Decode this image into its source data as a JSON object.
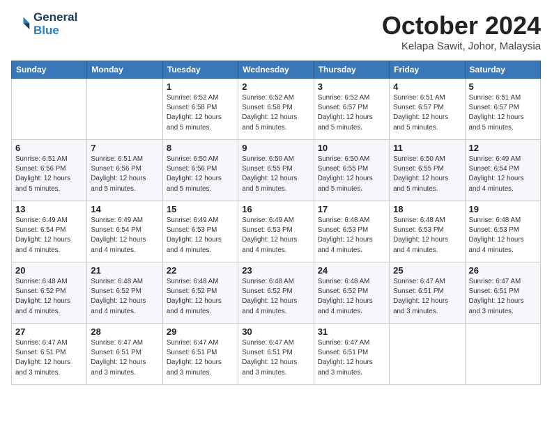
{
  "logo": {
    "line1": "General",
    "line2": "Blue"
  },
  "title": "October 2024",
  "subtitle": "Kelapa Sawit, Johor, Malaysia",
  "days_of_week": [
    "Sunday",
    "Monday",
    "Tuesday",
    "Wednesday",
    "Thursday",
    "Friday",
    "Saturday"
  ],
  "weeks": [
    [
      {
        "day": "",
        "info": ""
      },
      {
        "day": "",
        "info": ""
      },
      {
        "day": "1",
        "info": "Sunrise: 6:52 AM\nSunset: 6:58 PM\nDaylight: 12 hours and 5 minutes."
      },
      {
        "day": "2",
        "info": "Sunrise: 6:52 AM\nSunset: 6:58 PM\nDaylight: 12 hours and 5 minutes."
      },
      {
        "day": "3",
        "info": "Sunrise: 6:52 AM\nSunset: 6:57 PM\nDaylight: 12 hours and 5 minutes."
      },
      {
        "day": "4",
        "info": "Sunrise: 6:51 AM\nSunset: 6:57 PM\nDaylight: 12 hours and 5 minutes."
      },
      {
        "day": "5",
        "info": "Sunrise: 6:51 AM\nSunset: 6:57 PM\nDaylight: 12 hours and 5 minutes."
      }
    ],
    [
      {
        "day": "6",
        "info": "Sunrise: 6:51 AM\nSunset: 6:56 PM\nDaylight: 12 hours and 5 minutes."
      },
      {
        "day": "7",
        "info": "Sunrise: 6:51 AM\nSunset: 6:56 PM\nDaylight: 12 hours and 5 minutes."
      },
      {
        "day": "8",
        "info": "Sunrise: 6:50 AM\nSunset: 6:56 PM\nDaylight: 12 hours and 5 minutes."
      },
      {
        "day": "9",
        "info": "Sunrise: 6:50 AM\nSunset: 6:55 PM\nDaylight: 12 hours and 5 minutes."
      },
      {
        "day": "10",
        "info": "Sunrise: 6:50 AM\nSunset: 6:55 PM\nDaylight: 12 hours and 5 minutes."
      },
      {
        "day": "11",
        "info": "Sunrise: 6:50 AM\nSunset: 6:55 PM\nDaylight: 12 hours and 5 minutes."
      },
      {
        "day": "12",
        "info": "Sunrise: 6:49 AM\nSunset: 6:54 PM\nDaylight: 12 hours and 4 minutes."
      }
    ],
    [
      {
        "day": "13",
        "info": "Sunrise: 6:49 AM\nSunset: 6:54 PM\nDaylight: 12 hours and 4 minutes."
      },
      {
        "day": "14",
        "info": "Sunrise: 6:49 AM\nSunset: 6:54 PM\nDaylight: 12 hours and 4 minutes."
      },
      {
        "day": "15",
        "info": "Sunrise: 6:49 AM\nSunset: 6:53 PM\nDaylight: 12 hours and 4 minutes."
      },
      {
        "day": "16",
        "info": "Sunrise: 6:49 AM\nSunset: 6:53 PM\nDaylight: 12 hours and 4 minutes."
      },
      {
        "day": "17",
        "info": "Sunrise: 6:48 AM\nSunset: 6:53 PM\nDaylight: 12 hours and 4 minutes."
      },
      {
        "day": "18",
        "info": "Sunrise: 6:48 AM\nSunset: 6:53 PM\nDaylight: 12 hours and 4 minutes."
      },
      {
        "day": "19",
        "info": "Sunrise: 6:48 AM\nSunset: 6:53 PM\nDaylight: 12 hours and 4 minutes."
      }
    ],
    [
      {
        "day": "20",
        "info": "Sunrise: 6:48 AM\nSunset: 6:52 PM\nDaylight: 12 hours and 4 minutes."
      },
      {
        "day": "21",
        "info": "Sunrise: 6:48 AM\nSunset: 6:52 PM\nDaylight: 12 hours and 4 minutes."
      },
      {
        "day": "22",
        "info": "Sunrise: 6:48 AM\nSunset: 6:52 PM\nDaylight: 12 hours and 4 minutes."
      },
      {
        "day": "23",
        "info": "Sunrise: 6:48 AM\nSunset: 6:52 PM\nDaylight: 12 hours and 4 minutes."
      },
      {
        "day": "24",
        "info": "Sunrise: 6:48 AM\nSunset: 6:52 PM\nDaylight: 12 hours and 4 minutes."
      },
      {
        "day": "25",
        "info": "Sunrise: 6:47 AM\nSunset: 6:51 PM\nDaylight: 12 hours and 3 minutes."
      },
      {
        "day": "26",
        "info": "Sunrise: 6:47 AM\nSunset: 6:51 PM\nDaylight: 12 hours and 3 minutes."
      }
    ],
    [
      {
        "day": "27",
        "info": "Sunrise: 6:47 AM\nSunset: 6:51 PM\nDaylight: 12 hours and 3 minutes."
      },
      {
        "day": "28",
        "info": "Sunrise: 6:47 AM\nSunset: 6:51 PM\nDaylight: 12 hours and 3 minutes."
      },
      {
        "day": "29",
        "info": "Sunrise: 6:47 AM\nSunset: 6:51 PM\nDaylight: 12 hours and 3 minutes."
      },
      {
        "day": "30",
        "info": "Sunrise: 6:47 AM\nSunset: 6:51 PM\nDaylight: 12 hours and 3 minutes."
      },
      {
        "day": "31",
        "info": "Sunrise: 6:47 AM\nSunset: 6:51 PM\nDaylight: 12 hours and 3 minutes."
      },
      {
        "day": "",
        "info": ""
      },
      {
        "day": "",
        "info": ""
      }
    ]
  ]
}
